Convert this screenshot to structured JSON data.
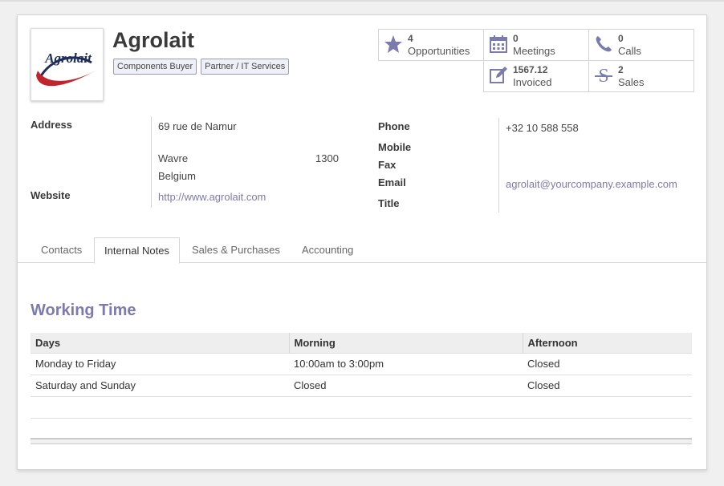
{
  "partner": {
    "name": "Agrolait",
    "logo_text": "Agrolait",
    "tags": [
      "Components Buyer",
      "Partner / IT Services"
    ]
  },
  "stats": [
    {
      "icon": "star-icon",
      "value": "4",
      "label": "Opportunities"
    },
    {
      "icon": "calendar-icon",
      "value": "0",
      "label": "Meetings"
    },
    {
      "icon": "phone-icon",
      "value": "0",
      "label": "Calls"
    },
    {
      "icon": "edit-icon",
      "value": "1567.12",
      "label": "Invoiced"
    },
    {
      "icon": "strikethrough-icon",
      "value": "2",
      "label": "Sales"
    }
  ],
  "left_fields": {
    "address_label": "Address",
    "street": "69 rue de Namur",
    "city": "Wavre",
    "zip": "1300",
    "country": "Belgium",
    "website_label": "Website",
    "website": "http://www.agrolait.com"
  },
  "right_fields": {
    "phone_label": "Phone",
    "phone": "+32 10 588 558",
    "mobile_label": "Mobile",
    "fax_label": "Fax",
    "email_label": "Email",
    "email": "agrolait@yourcompany.example.com",
    "title_label": "Title"
  },
  "tabs": [
    "Contacts",
    "Internal Notes",
    "Sales & Purchases",
    "Accounting"
  ],
  "active_tab": "Internal Notes",
  "working_time": {
    "title": "Working Time",
    "headers": [
      "Days",
      "Morning",
      "Afternoon"
    ],
    "rows": [
      [
        "Monday to Friday",
        "10:00am to 3:00pm",
        "Closed"
      ],
      [
        "Saturday and Sunday",
        "Closed",
        "Closed"
      ]
    ]
  },
  "colors": {
    "accent": "#7c7bad",
    "logo_red": "#c0242c",
    "logo_navy": "#1e2d5a"
  }
}
